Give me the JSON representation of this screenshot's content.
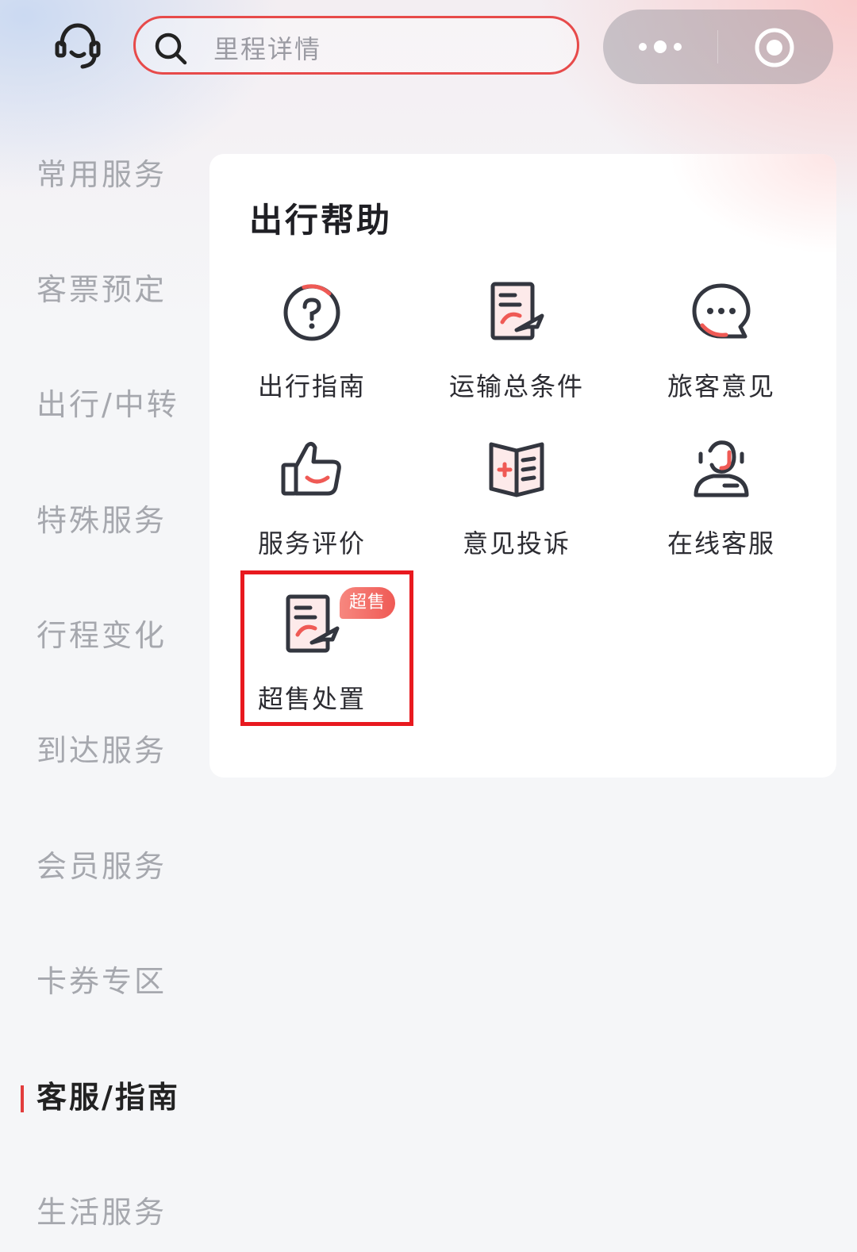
{
  "search": {
    "placeholder": "里程详情"
  },
  "icons": {
    "customer_service": "headset-icon",
    "search": "search-icon",
    "more": "more-dots-icon",
    "close": "target-circle-icon"
  },
  "sidebar": {
    "items": [
      {
        "label": "常用服务",
        "active": false
      },
      {
        "label": "客票预定",
        "active": false
      },
      {
        "label": "出行/中转",
        "active": false
      },
      {
        "label": "特殊服务",
        "active": false
      },
      {
        "label": "行程变化",
        "active": false
      },
      {
        "label": "到达服务",
        "active": false
      },
      {
        "label": "会员服务",
        "active": false
      },
      {
        "label": "卡券专区",
        "active": false
      },
      {
        "label": "客服/指南",
        "active": true
      },
      {
        "label": "生活服务",
        "active": false
      }
    ]
  },
  "card": {
    "title": "出行帮助",
    "items": [
      {
        "label": "出行指南",
        "icon": "question-circle-icon"
      },
      {
        "label": "运输总条件",
        "icon": "document-plane-icon"
      },
      {
        "label": "旅客意见",
        "icon": "chat-bubble-icon"
      },
      {
        "label": "服务评价",
        "icon": "thumbs-up-icon"
      },
      {
        "label": "意见投诉",
        "icon": "complaint-book-icon"
      },
      {
        "label": "在线客服",
        "icon": "agent-icon"
      },
      {
        "label": "超售处置",
        "icon": "document-plane-icon",
        "badge": "超售",
        "highlighted": true
      }
    ]
  },
  "colors": {
    "accent_red": "#e23d3d",
    "highlight_red": "#e8191f",
    "active_text": "#222222",
    "inactive_text": "#a6a8ae"
  }
}
